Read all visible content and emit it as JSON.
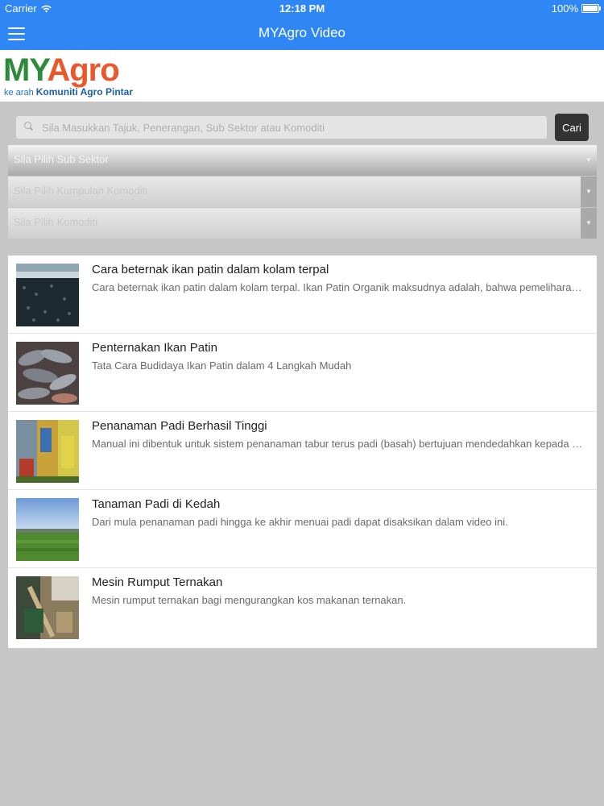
{
  "status_bar": {
    "carrier": "Carrier",
    "time": "12:18 PM",
    "battery": "100%",
    "icons": [
      "wifi-icon",
      "battery-icon"
    ]
  },
  "navbar": {
    "title": "MYAgro Video",
    "menu_icon": "hamburger-menu-icon"
  },
  "logo": {
    "brand_part1": "MY",
    "brand_part2": "Agro",
    "tagline_prefix": "ke arah",
    "tagline_emphasis": "Komuniti Agro Pintar",
    "colors": {
      "my": "#2e8b3c",
      "agro": "#e8582a",
      "tagline": "#1f6fbf"
    }
  },
  "search": {
    "placeholder": "Sila Masukkan Tajuk, Penerangan, Sub Sektor atau Komoditi",
    "value": "",
    "button_label": "Cari"
  },
  "filters": [
    {
      "label": "Sila Pilih Sub Sektor"
    },
    {
      "label": "Sila Pilih Kumpulan Komoditi"
    },
    {
      "label": "Sila Pilih Komoditi"
    }
  ],
  "videos": [
    {
      "title": "Cara beternak ikan patin dalam kolam terpal",
      "description": "Cara beternak ikan patin dalam kolam terpal. Ikan Patin Organik maksudnya adalah, bahwa pemeliharaan ikan patin secara organik",
      "thumbnail": "fish-pond-thumbnail"
    },
    {
      "title": "Penternakan Ikan Patin",
      "description": "Tata Cara Budidaya Ikan Patin dalam 4 Langkah Mudah",
      "thumbnail": "catfish-thumbnail"
    },
    {
      "title": "Penanaman Padi Berhasil Tinggi",
      "description": "Manual ini dibentuk untuk sistem penanaman tabur terus padi (basah) bertujuan mendedahkan kepada petani",
      "thumbnail": "rice-machine-thumbnail"
    },
    {
      "title": "Tanaman Padi di Kedah",
      "description": "Dari mula penanaman padi hingga ke akhir menuai padi dapat disaksikan dalam video ini.",
      "thumbnail": "paddy-field-thumbnail"
    },
    {
      "title": "Mesin Rumput Ternakan",
      "description": "Mesin rumput ternakan bagi mengurangkan kos makanan ternakan.",
      "thumbnail": "grass-machine-thumbnail"
    }
  ],
  "colors": {
    "accent": "#2f86f5",
    "page_background": "#c6c6c6",
    "button_dark": "#333333"
  }
}
